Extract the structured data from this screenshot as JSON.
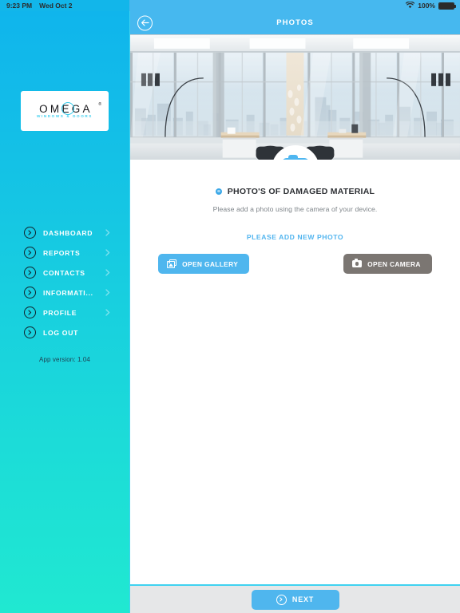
{
  "statusbar": {
    "time": "9:23 PM",
    "date": "Wed Oct 2",
    "battery_percent": "100%",
    "wifi_icon": "wifi-icon",
    "battery_icon": "battery-icon"
  },
  "sidebar": {
    "logo": {
      "word": "OMEGA",
      "trademark": "®",
      "subtitle": "WINDOWS  &  DOORS"
    },
    "items": [
      {
        "label": "DASHBOARD",
        "has_chevron": true
      },
      {
        "label": "REPORTS",
        "has_chevron": true
      },
      {
        "label": "CONTACTS",
        "has_chevron": true
      },
      {
        "label": "INFORMATI...",
        "has_chevron": true
      },
      {
        "label": "PROFILE",
        "has_chevron": true
      },
      {
        "label": "LOG OUT",
        "has_chevron": false
      }
    ],
    "app_version": "App version: 1.04"
  },
  "topbar": {
    "title": "PHOTOS",
    "back_icon": "back-arrow-icon"
  },
  "hero": {
    "alt": "Modern office interior with floor-to-ceiling glass windows overlooking city skyline",
    "badge_icon": "camera-icon"
  },
  "section": {
    "title": "PHOTO'S OF DAMAGED MATERIAL",
    "subtitle": "Please add a photo using the camera of your device.",
    "add_link": "PLEASE ADD NEW PHOTO",
    "status_dot_color": "#3ba8e8"
  },
  "buttons": {
    "gallery": {
      "label": "OPEN GALLERY",
      "icon": "gallery-icon",
      "color": "#4fb6ee"
    },
    "camera": {
      "label": "OPEN CAMERA",
      "icon": "camera-icon",
      "color": "#7b7672"
    }
  },
  "footer": {
    "next_label": "NEXT",
    "next_icon": "chevron-right-circle-icon"
  },
  "colors": {
    "sidebar_top": "#10b5ec",
    "sidebar_bottom": "#20e8d1",
    "accent_blue": "#4fb6ee",
    "topbar_blue": "#46b8ef",
    "footer_gray": "#e6e7e8"
  }
}
